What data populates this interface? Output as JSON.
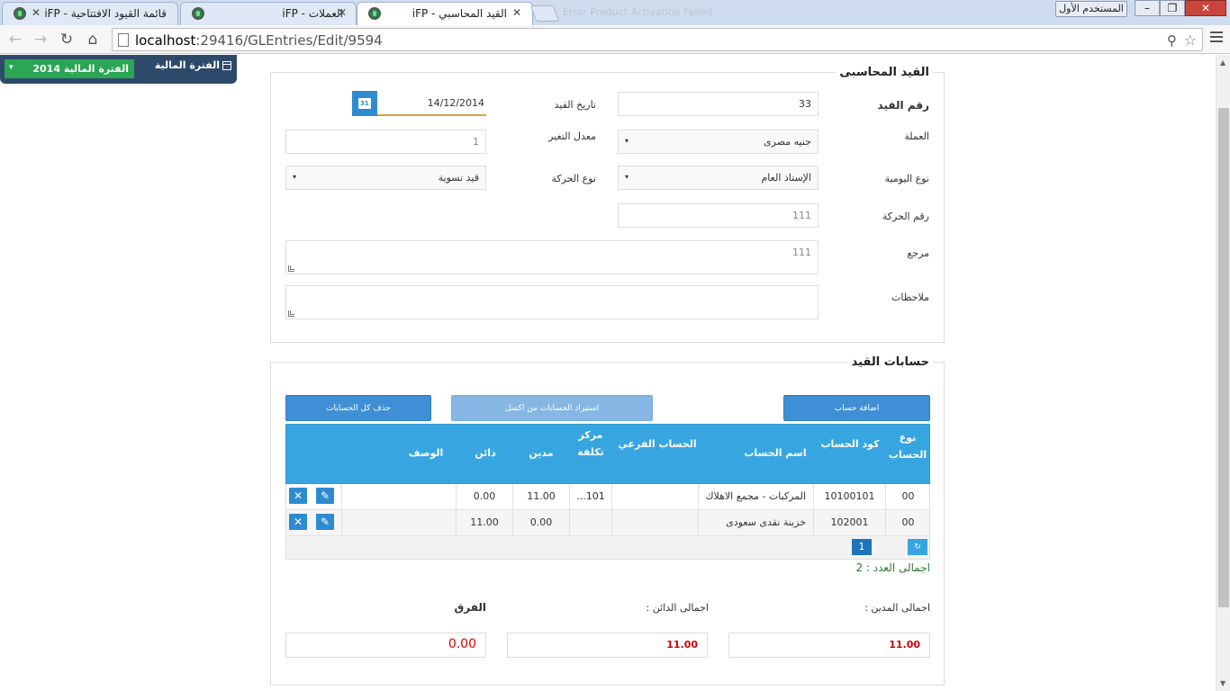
{
  "browser": {
    "tabs": [
      {
        "title": "القيد المحاسبي - iFP",
        "active": true
      },
      {
        "title": "العملات - iFP",
        "active": false
      },
      {
        "title": "قائمة القيود الافتتاحية - iFP",
        "active": false
      }
    ],
    "ghost_tab": "Error Product Activation Failed",
    "user_button": "المستخدم الأول",
    "url_host": "localhost",
    "url_rest": ":29416/GLEntries/Edit/9594",
    "icons": {
      "back": "arrow-left-icon",
      "forward": "arrow-right-icon",
      "reload": "reload-icon",
      "home": "home-icon",
      "zoom": "zoom-icon",
      "star": "star-icon",
      "menu": "menu-icon"
    }
  },
  "period": {
    "label": "الفترة المالية",
    "value": "الفترة المالية 2014"
  },
  "entry": {
    "section_title": "القيد المحاسبى",
    "entry_no_label": "رقم القيد",
    "entry_no": "33",
    "entry_date_label": "تاريخ القيد",
    "entry_date": "14/12/2014",
    "currency_label": "العملة",
    "currency": "جنيه مصرى",
    "rate_label": "معدل التغير",
    "rate": "1",
    "journal_type_label": "نوع اليومية",
    "journal_type": "الإستاذ العام",
    "movement_type_label": "نوع الحركة",
    "movement_type": "قيد تسوية",
    "movement_no_label": "رقم الحركة",
    "movement_no": "111",
    "reference_label": "مرجع",
    "reference": "111",
    "notes_label": "ملاحظات",
    "notes": ""
  },
  "accounts": {
    "section_title": "حسابات القيد",
    "add_button": "اضافة حساب",
    "import_button": "استيراد الحسابات من اكسل",
    "delete_all_button": "حذف كل الحسابات",
    "columns": [
      "نوع الحساب",
      "كود الحساب",
      "اسم الحساب",
      "الحساب الفرعي",
      "مركز تكلفة",
      "مدين",
      "دائن",
      "الوصف"
    ],
    "rows": [
      {
        "type": "00",
        "code": "10100101",
        "name": "المركبات - مجمع الاهلاك",
        "sub": "",
        "cost_center": "101...",
        "debit": "11.00",
        "credit": "0.00",
        "desc": ""
      },
      {
        "type": "00",
        "code": "102001",
        "name": "خزينة نقدى سعودى",
        "sub": "",
        "cost_center": "",
        "debit": "0.00",
        "credit": "11.00",
        "desc": ""
      }
    ],
    "current_page": "1",
    "pager_nav": "↻",
    "total_count": "اجمالى العدد : 2"
  },
  "totals": {
    "debit_label": "اجمالى المدين :",
    "credit_label": "اجمالى الدائن :",
    "diff_label": "الفرق",
    "debit": "11.00",
    "credit": "11.00",
    "diff": "0.00"
  },
  "colors": {
    "header_blue": "#37a6e0",
    "button_blue": "#3f8fd6",
    "period_green": "#2aa655",
    "period_bg": "#2d4a6a",
    "total_red": "#cc0000"
  }
}
